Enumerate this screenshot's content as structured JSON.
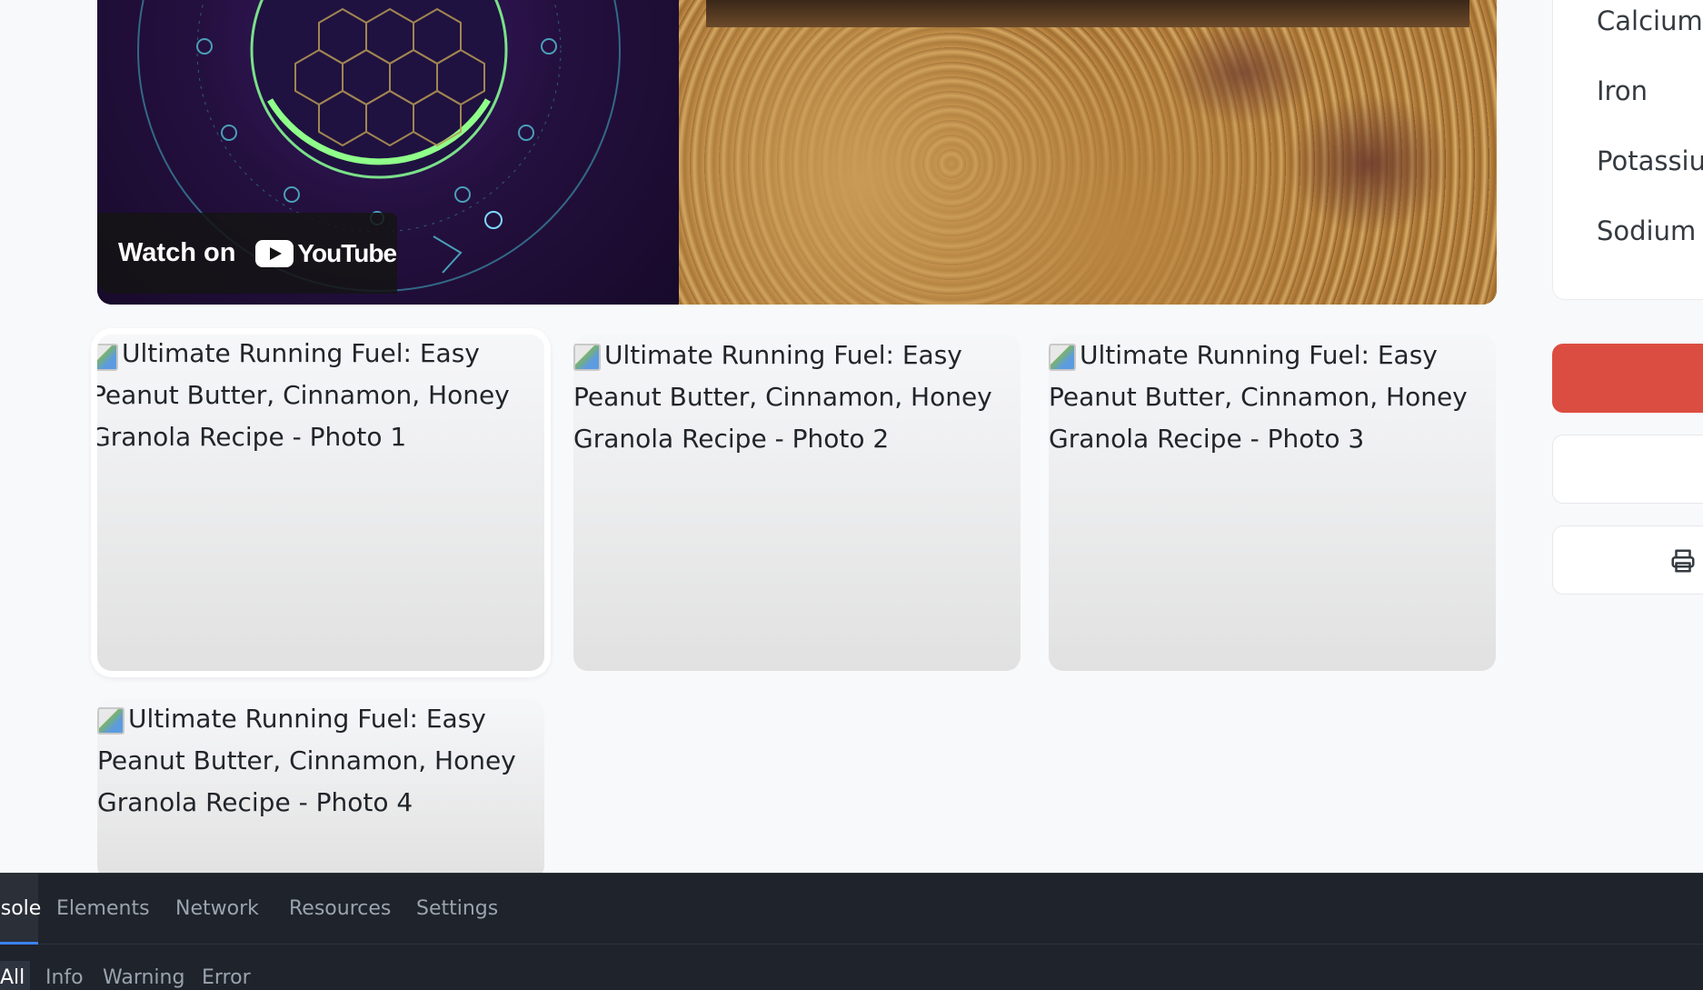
{
  "video": {
    "watch_label": "Watch on",
    "youtube_label": "YouTube"
  },
  "photos": [
    {
      "alt": "Ultimate Running Fuel: Easy Peanut Butter, Cinnamon, Honey Granola Recipe - Photo 1"
    },
    {
      "alt": "Ultimate Running Fuel: Easy Peanut Butter, Cinnamon, Honey Granola Recipe - Photo 2"
    },
    {
      "alt": "Ultimate Running Fuel: Easy Peanut Butter, Cinnamon, Honey Granola Recipe - Photo 3"
    },
    {
      "alt": "Ultimate Running Fuel: Easy Peanut Butter, Cinnamon, Honey Granola Recipe - Photo 4"
    }
  ],
  "sidebar": {
    "nutrients": [
      "Calcium",
      "Iron",
      "Potassium",
      "Sodium"
    ],
    "print_icon": "printer-icon",
    "accent_color": "#dc4d41"
  },
  "devtools": {
    "tabs": [
      "Console",
      "Elements",
      "Network",
      "Resources",
      "Settings"
    ],
    "active_tab": "Console",
    "filters": [
      "All",
      "Info",
      "Warning",
      "Error"
    ],
    "active_filter": "All"
  }
}
